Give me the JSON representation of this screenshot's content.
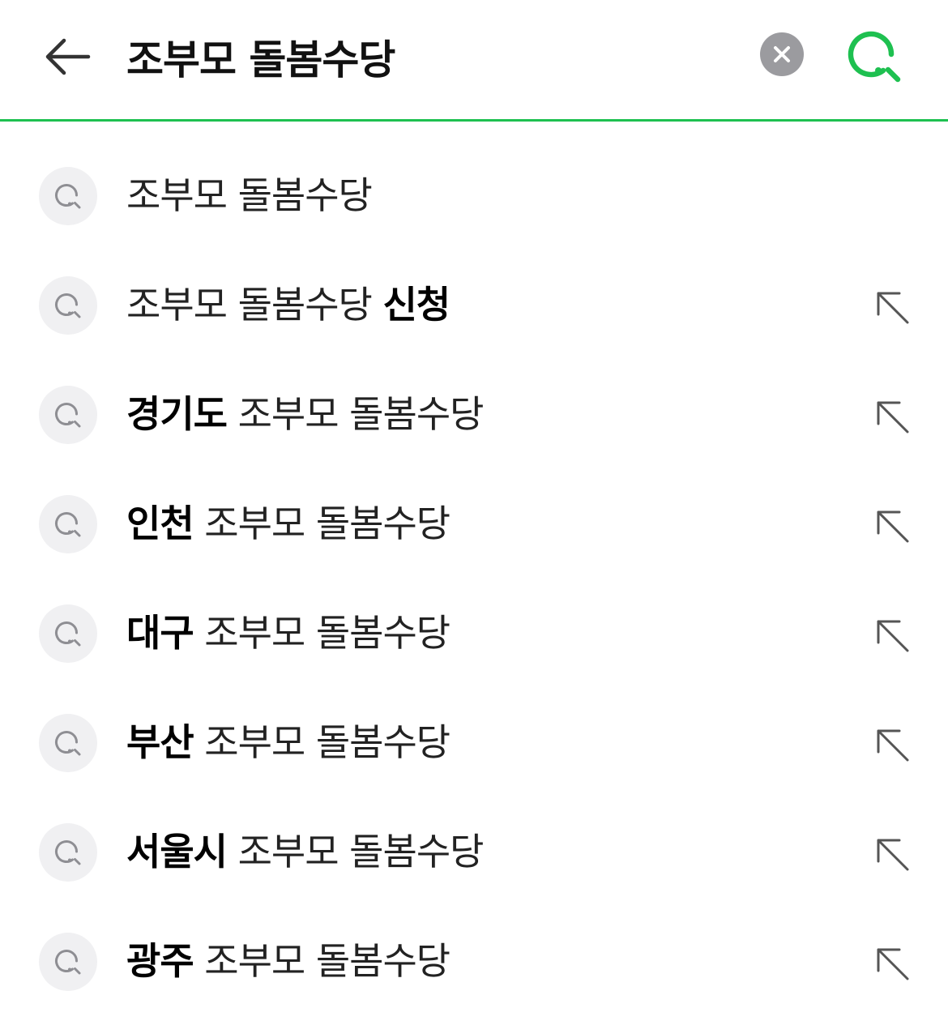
{
  "search": {
    "value": "조부모 돌봄수당",
    "placeholder": ""
  },
  "icons": {
    "back": "arrow-left-icon",
    "clear": "clear-x-icon",
    "search": "search-icon",
    "suggestion": "search-icon",
    "fill": "arrow-up-left-icon"
  },
  "colors": {
    "accent": "#1ec050",
    "clear_bg": "#9b9b9f",
    "icon_bg": "#f0f0f2",
    "icon_gray": "#8e8e93"
  },
  "suggestions": [
    {
      "prefix": "",
      "base": "조부모 돌봄수당",
      "suffix": "",
      "fill": false
    },
    {
      "prefix": "",
      "base": "조부모 돌봄수당 ",
      "suffix": "신청",
      "fill": true
    },
    {
      "prefix": "경기도",
      "base": " 조부모 돌봄수당",
      "suffix": "",
      "fill": true
    },
    {
      "prefix": "인천",
      "base": " 조부모 돌봄수당",
      "suffix": "",
      "fill": true
    },
    {
      "prefix": "대구",
      "base": " 조부모 돌봄수당",
      "suffix": "",
      "fill": true
    },
    {
      "prefix": "부산",
      "base": " 조부모 돌봄수당",
      "suffix": "",
      "fill": true
    },
    {
      "prefix": "서울시",
      "base": " 조부모 돌봄수당",
      "suffix": "",
      "fill": true
    },
    {
      "prefix": "광주",
      "base": " 조부모 돌봄수당",
      "suffix": "",
      "fill": true
    }
  ]
}
